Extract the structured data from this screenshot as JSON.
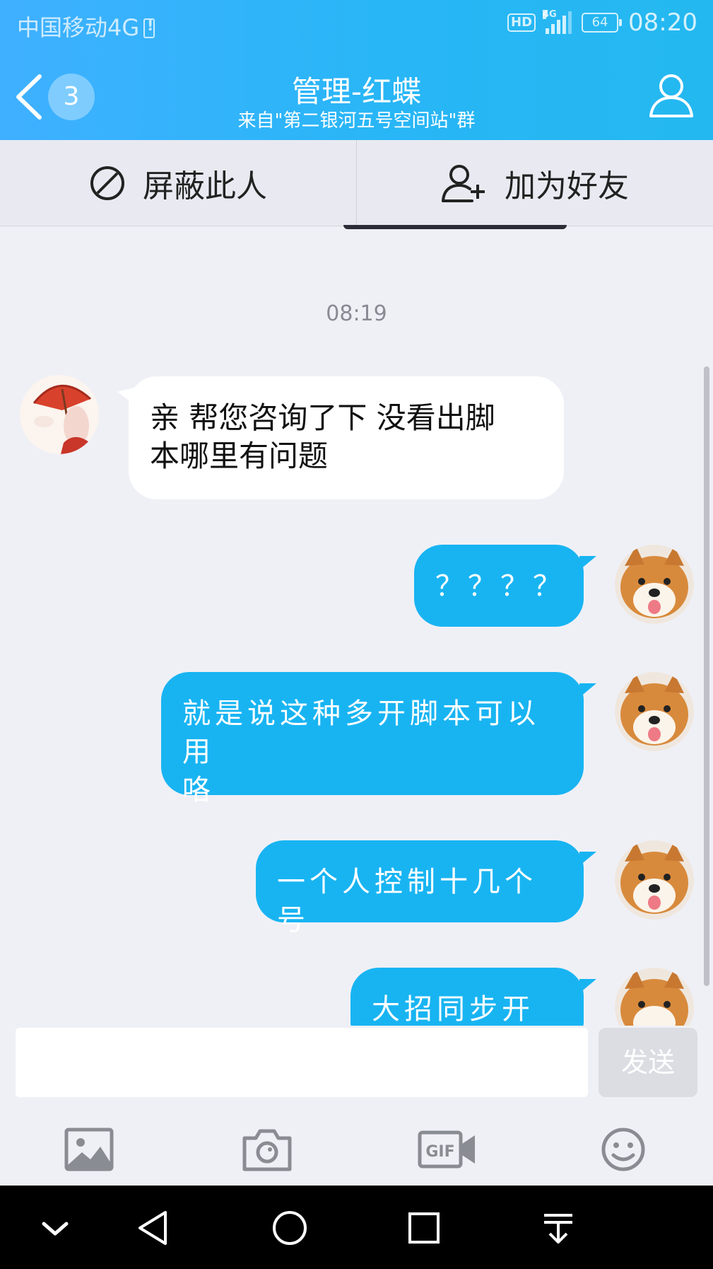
{
  "status_bar": {
    "carrier": "中国移动4G",
    "hd": "HD",
    "network": "4G",
    "battery": "64",
    "time": "08:20"
  },
  "header": {
    "unread_count": "3",
    "title": "管理-红蝶",
    "subtitle": "来自\"第二银河五号空间站\"群",
    "gradient_start": "#3fb0ff",
    "gradient_end": "#24b8f0"
  },
  "actions": {
    "block_label": "屏蔽此人",
    "add_friend_label": "加为好友"
  },
  "chat": {
    "timestamp": "08:19",
    "messages": [
      {
        "direction": "in",
        "text_line1": "亲 帮您咨询了下 没看出脚",
        "text_line2": "本哪里有问题"
      },
      {
        "direction": "out",
        "text": "？？？？"
      },
      {
        "direction": "out",
        "text_line1": "就是说这种多开脚本可以用",
        "text_line2": "咯"
      },
      {
        "direction": "out",
        "text": "一个人控制十几个号"
      },
      {
        "direction": "out",
        "text": "大招同步开启"
      }
    ],
    "bubble_out_color": "#18b4f2",
    "bubble_in_color": "#ffffff"
  },
  "input": {
    "value": "",
    "send_label": "发送"
  },
  "toolbar_icons": [
    "image-icon",
    "camera-icon",
    "gif-video-icon",
    "emoji-icon"
  ],
  "nav_icons": [
    "collapse-chevron-icon",
    "back-triangle-icon",
    "home-circle-icon",
    "recents-square-icon",
    "notification-pull-icon"
  ]
}
